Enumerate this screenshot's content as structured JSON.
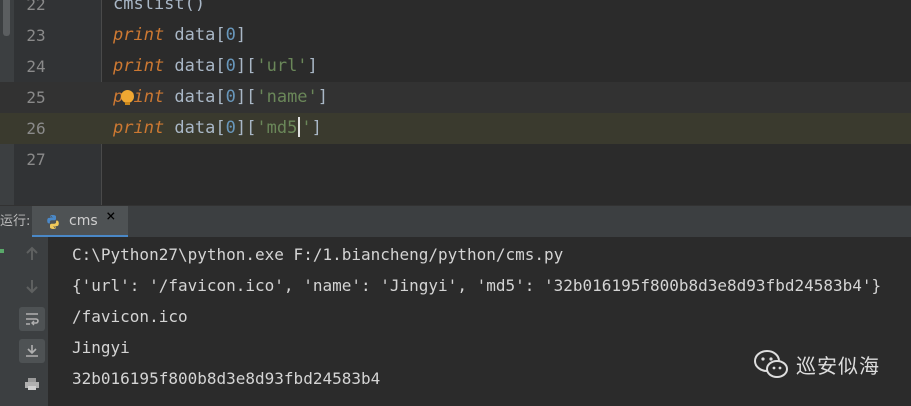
{
  "editor": {
    "lines": [
      {
        "num": "22",
        "text": "cmslist()"
      },
      {
        "num": "23",
        "kw": "print",
        "var": " data",
        "i1": "0"
      },
      {
        "num": "24",
        "kw": "print",
        "var": " data",
        "i1": "0",
        "key": "'url'"
      },
      {
        "num": "25",
        "kw": "print",
        "var": " data",
        "i1": "0",
        "key": "'name'"
      },
      {
        "num": "26",
        "kw": "print",
        "var": " data",
        "i1": "0",
        "key_a": "'md5",
        "key_b": "'"
      },
      {
        "num": "27"
      }
    ]
  },
  "run_panel": {
    "label": "运行:",
    "tab_name": "cms",
    "tab_close": "×"
  },
  "console": {
    "lines": [
      "C:\\Python27\\python.exe F:/1.biancheng/python/cms.py",
      "{'url': '/favicon.ico', 'name': 'Jingyi', 'md5': '32b016195f800b8d3e8d93fbd24583b4'}",
      "/favicon.ico",
      "Jingyi",
      "32b016195f800b8d3e8d93fbd24583b4"
    ]
  },
  "watermark": {
    "text": "巡安似海",
    "icon": "wechat-icon"
  },
  "colors": {
    "keyword": "#cc7832",
    "string": "#6a8759",
    "number": "#6897bb",
    "tab_underline": "#4a88c7"
  }
}
